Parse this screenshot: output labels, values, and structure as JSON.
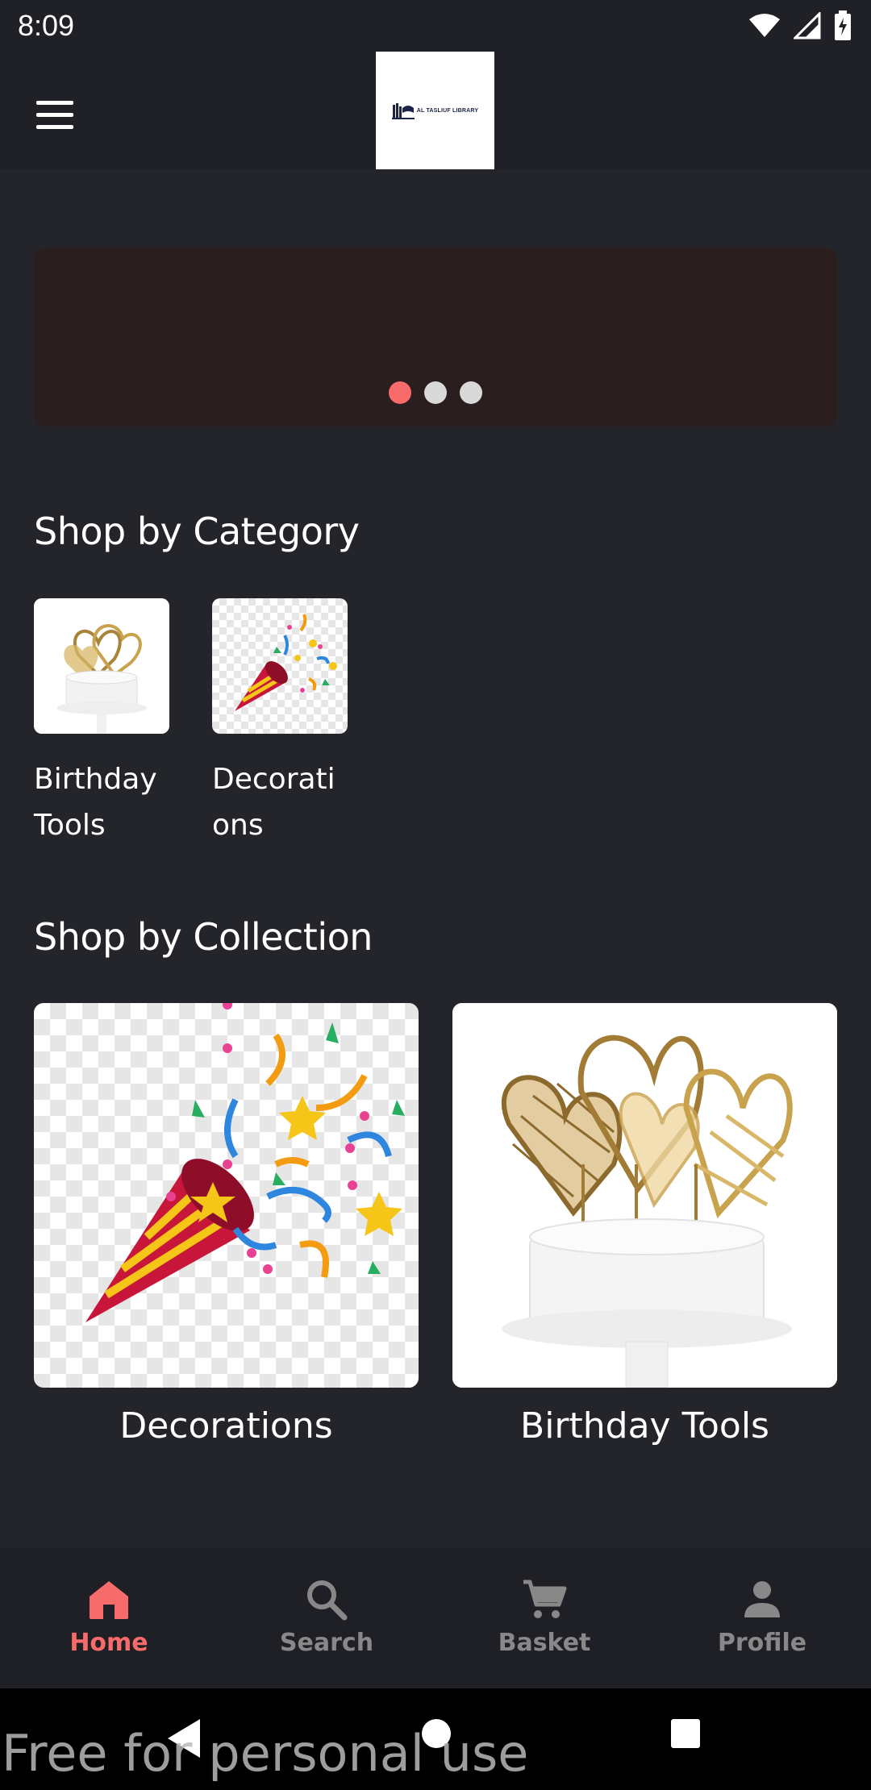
{
  "status_bar": {
    "time": "8:09",
    "icons": [
      "wifi-icon",
      "signal-icon",
      "battery-icon"
    ]
  },
  "app_bar": {
    "menu_icon": "hamburger-menu-icon",
    "logo_text": "AL TASLIUF LIBRARY"
  },
  "banner": {
    "page_count": 3,
    "active_page": 1,
    "background_color": "#2a1e1f",
    "active_dot_color": "#f86b6b"
  },
  "categories": {
    "title": "Shop by Category",
    "items": [
      {
        "label": "Birthday Tools",
        "image": "cake-topper-image"
      },
      {
        "label": "Decorations",
        "image": "party-popper-image"
      }
    ]
  },
  "collections": {
    "title": "Shop by Collection",
    "items": [
      {
        "label": "Decorations",
        "image": "party-popper-image"
      },
      {
        "label": "Birthday Tools",
        "image": "cake-topper-image"
      }
    ]
  },
  "bottom_nav": {
    "active_color": "#f86b6b",
    "inactive_color": "#888888",
    "items": [
      {
        "label": "Home",
        "icon": "home-icon",
        "active": true
      },
      {
        "label": "Search",
        "icon": "search-icon",
        "active": false
      },
      {
        "label": "Basket",
        "icon": "cart-icon",
        "active": false
      },
      {
        "label": "Profile",
        "icon": "person-icon",
        "active": false
      }
    ]
  },
  "watermark": "Free for personal use"
}
